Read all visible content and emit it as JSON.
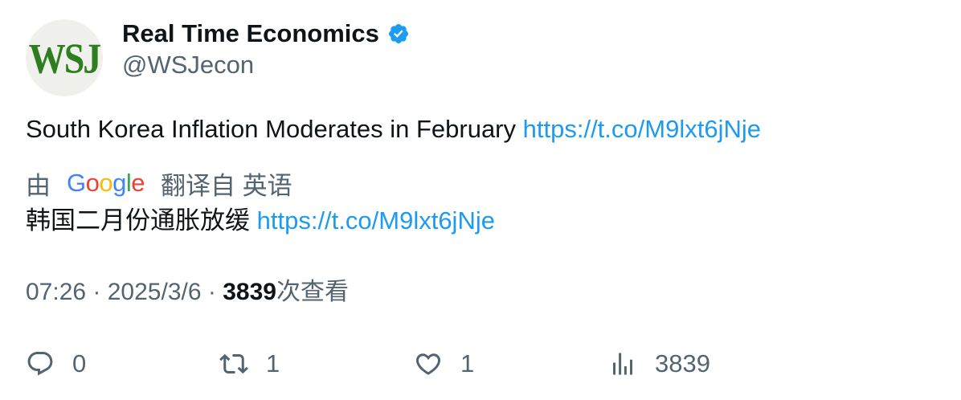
{
  "author": {
    "avatar_text": "WSJ",
    "name": "Real Time Economics",
    "handle": "@WSJecon",
    "verified": true
  },
  "tweet": {
    "text": "South Korea Inflation Moderates in February",
    "link": "https://t.co/M9lxt6jNje"
  },
  "translation": {
    "by_label": "由",
    "provider": "Google",
    "translated_from": "翻译自 英语",
    "text": "韩国二月份通胀放缓",
    "link": "https://t.co/M9lxt6jNje"
  },
  "meta": {
    "time": "07:26",
    "separator": " · ",
    "date": "2025/3/6",
    "views": "3839",
    "views_label": "次查看"
  },
  "actions": {
    "replies": "0",
    "retweets": "1",
    "likes": "1",
    "views": "3839"
  },
  "colors": {
    "link": "#1d9bf0",
    "muted": "#536471",
    "text": "#0f1419",
    "verified": "#1d9bf0"
  },
  "icons": [
    "verified-badge-icon",
    "reply-icon",
    "retweet-icon",
    "like-icon",
    "views-icon"
  ]
}
